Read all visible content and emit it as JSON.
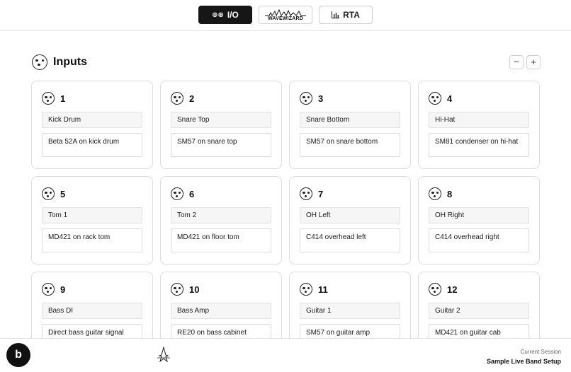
{
  "nav": {
    "io_label": "I/O",
    "wavewizard_label": "WAVEWIZARD",
    "rta_label": "RTA"
  },
  "section": {
    "title": "Inputs",
    "minus": "−",
    "plus": "+"
  },
  "inputs": [
    {
      "num": "1",
      "name": "Kick Drum",
      "desc": "Beta 52A on kick drum"
    },
    {
      "num": "2",
      "name": "Snare Top",
      "desc": "SM57 on snare top"
    },
    {
      "num": "3",
      "name": "Snare Bottom",
      "desc": "SM57 on snare bottom"
    },
    {
      "num": "4",
      "name": "Hi-Hat",
      "desc": "SM81 condenser on hi-hat"
    },
    {
      "num": "5",
      "name": "Tom 1",
      "desc": "MD421 on rack tom"
    },
    {
      "num": "6",
      "name": "Tom 2",
      "desc": "MD421 on floor tom"
    },
    {
      "num": "7",
      "name": "OH Left",
      "desc": "C414 overhead left"
    },
    {
      "num": "8",
      "name": "OH Right",
      "desc": "C414 overhead right"
    },
    {
      "num": "9",
      "name": "Bass DI",
      "desc": "Direct bass guitar signal"
    },
    {
      "num": "10",
      "name": "Bass Amp",
      "desc": "RE20 on bass cabinet"
    },
    {
      "num": "11",
      "name": "Guitar 1",
      "desc": "SM57 on guitar amp"
    },
    {
      "num": "12",
      "name": "Guitar 2",
      "desc": "MD421 on guitar cab"
    }
  ],
  "footer": {
    "badge_letter": "b",
    "session_label": "Current Session",
    "session_name": "Sample Live Band Setup"
  }
}
